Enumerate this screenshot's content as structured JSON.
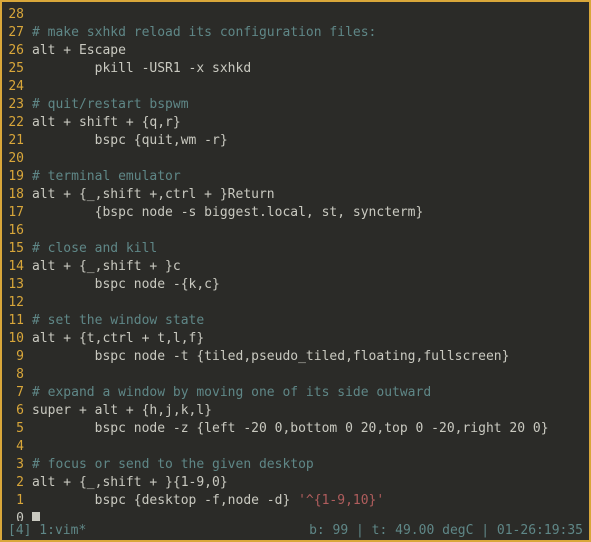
{
  "lines": [
    {
      "n": "28",
      "abs": false,
      "segs": []
    },
    {
      "n": "27",
      "abs": false,
      "segs": [
        {
          "cls": "tok-comment",
          "t": "# make sxhkd reload its configuration files:"
        }
      ]
    },
    {
      "n": "26",
      "abs": false,
      "segs": [
        {
          "cls": "tok-default",
          "t": "alt + Escape"
        }
      ]
    },
    {
      "n": "25",
      "abs": false,
      "segs": [
        {
          "cls": "tok-default",
          "t": "        pkill -USR1 -x sxhkd"
        }
      ]
    },
    {
      "n": "24",
      "abs": false,
      "segs": []
    },
    {
      "n": "23",
      "abs": false,
      "segs": [
        {
          "cls": "tok-comment",
          "t": "# quit/restart bspwm"
        }
      ]
    },
    {
      "n": "22",
      "abs": false,
      "segs": [
        {
          "cls": "tok-default",
          "t": "alt + shift + {q,r}"
        }
      ]
    },
    {
      "n": "21",
      "abs": false,
      "segs": [
        {
          "cls": "tok-default",
          "t": "        bspc {quit,wm -r}"
        }
      ]
    },
    {
      "n": "20",
      "abs": false,
      "segs": []
    },
    {
      "n": "19",
      "abs": false,
      "segs": [
        {
          "cls": "tok-comment",
          "t": "# terminal emulator"
        }
      ]
    },
    {
      "n": "18",
      "abs": false,
      "segs": [
        {
          "cls": "tok-default",
          "t": "alt + {_,shift +,ctrl + }Return"
        }
      ]
    },
    {
      "n": "17",
      "abs": false,
      "segs": [
        {
          "cls": "tok-default",
          "t": "        {bspc node -s biggest.local, st, syncterm}"
        }
      ]
    },
    {
      "n": "16",
      "abs": false,
      "segs": []
    },
    {
      "n": "15",
      "abs": false,
      "segs": [
        {
          "cls": "tok-comment",
          "t": "# close and kill"
        }
      ]
    },
    {
      "n": "14",
      "abs": false,
      "segs": [
        {
          "cls": "tok-default",
          "t": "alt + {_,shift + }c"
        }
      ]
    },
    {
      "n": "13",
      "abs": false,
      "segs": [
        {
          "cls": "tok-default",
          "t": "        bspc node -{k,c}"
        }
      ]
    },
    {
      "n": "12",
      "abs": false,
      "segs": []
    },
    {
      "n": "11",
      "abs": false,
      "segs": [
        {
          "cls": "tok-comment",
          "t": "# set the window state"
        }
      ]
    },
    {
      "n": "10",
      "abs": false,
      "segs": [
        {
          "cls": "tok-default",
          "t": "alt + {t,ctrl + t,l,f}"
        }
      ]
    },
    {
      "n": "9",
      "abs": false,
      "segs": [
        {
          "cls": "tok-default",
          "t": "        bspc node -t {tiled,pseudo_tiled,floating,fullscreen}"
        }
      ]
    },
    {
      "n": "8",
      "abs": false,
      "segs": []
    },
    {
      "n": "7",
      "abs": false,
      "segs": [
        {
          "cls": "tok-comment",
          "t": "# expand a window by moving one of its side outward"
        }
      ]
    },
    {
      "n": "6",
      "abs": false,
      "segs": [
        {
          "cls": "tok-default",
          "t": "super + alt + {h,j,k,l}"
        }
      ]
    },
    {
      "n": "5",
      "abs": false,
      "segs": [
        {
          "cls": "tok-default",
          "t": "        bspc node -z {left -20 0,bottom 0 20,top 0 -20,right 20 0}"
        }
      ]
    },
    {
      "n": "4",
      "abs": false,
      "segs": []
    },
    {
      "n": "3",
      "abs": false,
      "segs": [
        {
          "cls": "tok-comment",
          "t": "# focus or send to the given desktop"
        }
      ]
    },
    {
      "n": "2",
      "abs": false,
      "segs": [
        {
          "cls": "tok-default",
          "t": "alt + {_,shift + }{1-9,0}"
        }
      ]
    },
    {
      "n": "1",
      "abs": false,
      "segs": [
        {
          "cls": "tok-default",
          "t": "        bspc {desktop -f,node -d} "
        },
        {
          "cls": "tok-special",
          "t": "'^{1-9,10}'"
        }
      ]
    },
    {
      "n": "0",
      "abs": true,
      "segs": [],
      "cursor": true
    }
  ],
  "status": {
    "left": "[4] 1:vim*",
    "right": "b: 99 | t: 49.00 degC | 01-26:19:35"
  }
}
